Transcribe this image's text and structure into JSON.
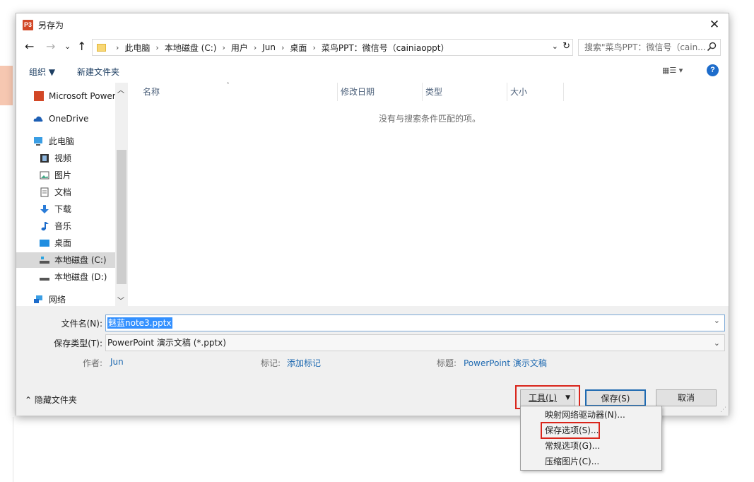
{
  "window": {
    "title": "另存为",
    "app_icon_label": "P3",
    "close_label": "✕"
  },
  "nav": {
    "back": "←",
    "forward": "→",
    "recent": "⌄",
    "up": "↑",
    "dropdown": "⌄",
    "refresh": "↻"
  },
  "breadcrumb": [
    "此电脑",
    "本地磁盘 (C:)",
    "用户",
    "Jun",
    "桌面",
    "菜鸟PPT：微信号（cainiaoppt）"
  ],
  "search": {
    "placeholder": "搜索\"菜鸟PPT：微信号（cain..."
  },
  "toolbar": {
    "organize": "组织 ▼",
    "new_folder": "新建文件夹",
    "view": "▦☰ ▾",
    "help": "?"
  },
  "sidebar": {
    "items": [
      {
        "label": "Microsoft Power",
        "icon": "powerpoint-icon"
      },
      {
        "label": "OneDrive",
        "icon": "onedrive-icon"
      },
      {
        "label": "此电脑",
        "icon": "computer-icon"
      },
      {
        "label": "视频",
        "icon": "video-icon"
      },
      {
        "label": "图片",
        "icon": "picture-icon"
      },
      {
        "label": "文档",
        "icon": "document-icon"
      },
      {
        "label": "下载",
        "icon": "download-icon"
      },
      {
        "label": "音乐",
        "icon": "music-icon"
      },
      {
        "label": "桌面",
        "icon": "desktop-icon"
      },
      {
        "label": "本地磁盘 (C:)",
        "icon": "drive-icon"
      },
      {
        "label": "本地磁盘 (D:)",
        "icon": "drive-icon"
      },
      {
        "label": "网络",
        "icon": "network-icon"
      }
    ]
  },
  "columns": [
    "名称",
    "修改日期",
    "类型",
    "大小"
  ],
  "empty_message": "没有与搜索条件匹配的项。",
  "form": {
    "filename_label": "文件名(N):",
    "filename_value": "魅蓝note3.pptx",
    "filetype_label": "保存类型(T):",
    "filetype_value": "PowerPoint 演示文稿 (*.pptx)",
    "author_label": "作者:",
    "author_value": "Jun",
    "tags_label": "标记:",
    "tags_value": "添加标记",
    "title_label": "标题:",
    "title_value": "PowerPoint 演示文稿"
  },
  "footer": {
    "hide_folders": "隐藏文件夹",
    "tools": "工具(L)",
    "save": "保存(S)",
    "cancel": "取消"
  },
  "tools_menu": [
    "映射网络驱动器(N)...",
    "保存选项(S)...",
    "常规选项(G)...",
    "压缩图片(C)..."
  ],
  "colors": {
    "accent": "#1f6ab1",
    "highlight_box": "#d9261c",
    "selection": "#3390ff"
  }
}
